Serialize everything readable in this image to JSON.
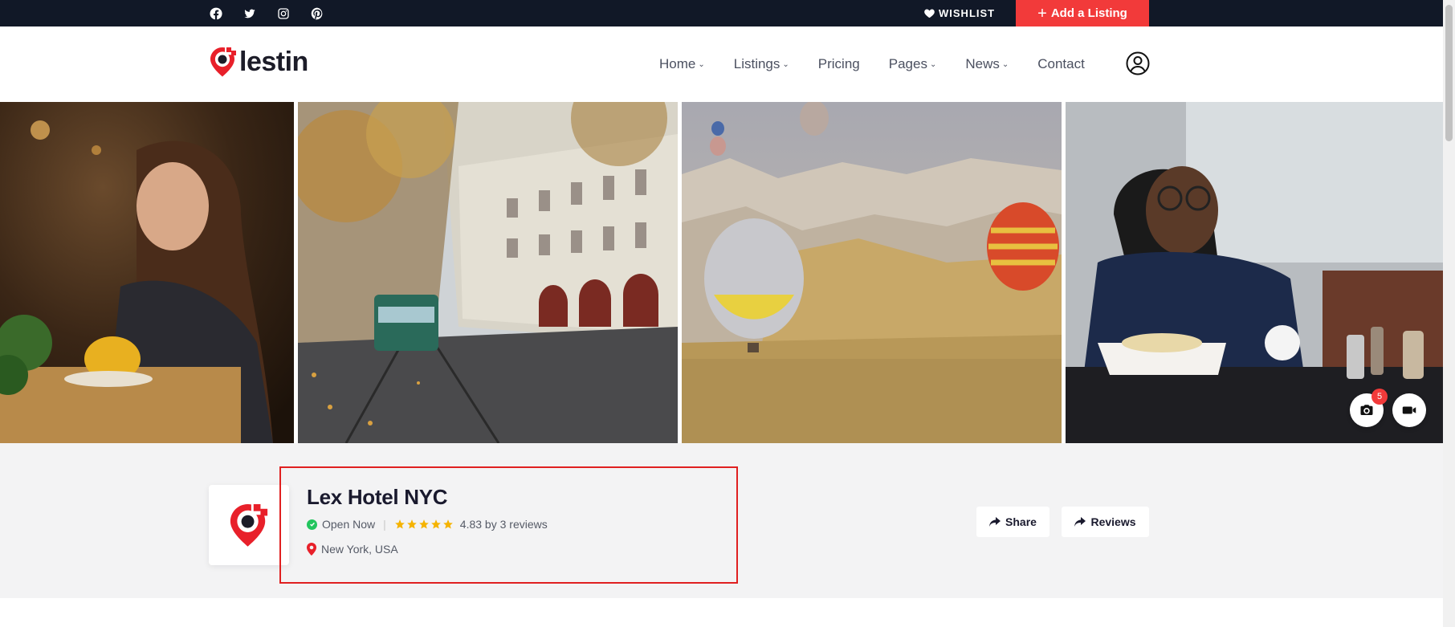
{
  "topbar": {
    "social": [
      "facebook-icon",
      "twitter-icon",
      "instagram-icon",
      "pinterest-icon"
    ],
    "wishlist_label": "WISHLIST",
    "add_listing_label": "Add a Listing"
  },
  "header": {
    "logo_text": "lestin",
    "nav": [
      {
        "label": "Home",
        "dropdown": true
      },
      {
        "label": "Listings",
        "dropdown": true
      },
      {
        "label": "Pricing",
        "dropdown": false
      },
      {
        "label": "Pages",
        "dropdown": true
      },
      {
        "label": "News",
        "dropdown": true
      },
      {
        "label": "Contact",
        "dropdown": false
      }
    ]
  },
  "gallery": {
    "photos": [
      "woman eating at cafe",
      "autumn street with tram",
      "hot air balloons over valley",
      "man dining at restaurant"
    ],
    "photo_count": "5"
  },
  "listing": {
    "title": "Lex Hotel NYC",
    "status": "Open Now",
    "rating_text": "4.83 by 3 reviews",
    "rating": 4.83,
    "location": "New York, USA",
    "share_label": "Share",
    "reviews_label": "Reviews"
  },
  "colors": {
    "accent": "#f23a3a",
    "topbar": "#111827",
    "star": "#f5b301",
    "open": "#22c55e"
  }
}
